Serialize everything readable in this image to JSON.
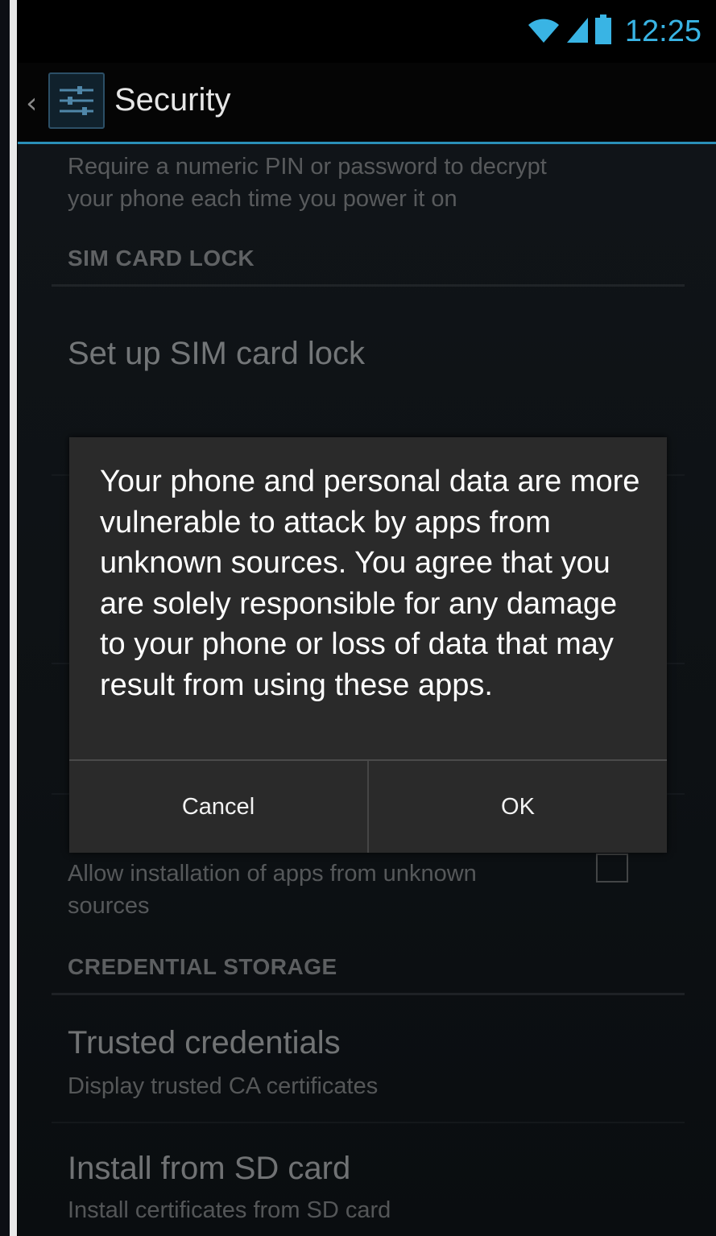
{
  "status_bar": {
    "time": "12:25",
    "icons": [
      "wifi-icon",
      "signal-icon",
      "battery-icon"
    ],
    "accent_color": "#39b4e4"
  },
  "action_bar": {
    "title": "Security",
    "back_icon": "chevron-left-icon",
    "app_icon": "settings-sliders-icon"
  },
  "list": {
    "encrypt_summary_line1": "Require a numeric PIN or password to decrypt",
    "encrypt_summary_line2": "your phone each time you power it on",
    "sim_header": "SIM CARD LOCK",
    "sim_lock_title": "Set up SIM card lock",
    "unknown_sources_summary_line1": "Allow installation of apps from unknown",
    "unknown_sources_summary_line2": "sources",
    "unknown_sources_checked": false,
    "credential_header": "CREDENTIAL STORAGE",
    "trusted_title": "Trusted credentials",
    "trusted_summary": "Display trusted CA certificates",
    "install_title": "Install from SD card",
    "install_summary": "Install certificates from SD card"
  },
  "dialog": {
    "message": "Your phone and personal data are more vulnerable to attack by apps from unknown sources. You agree that you are solely responsible for any damage to your phone or loss of data that may result from using these apps.",
    "cancel_label": "Cancel",
    "ok_label": "OK"
  }
}
